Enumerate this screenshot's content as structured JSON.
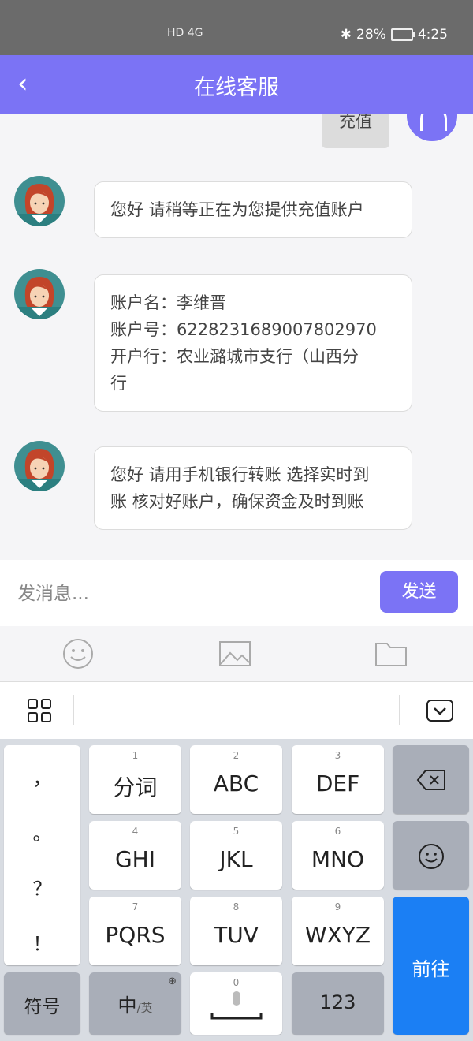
{
  "status_bar": {
    "network": "HD 4G",
    "battery": "28%",
    "time": "4:25"
  },
  "header": {
    "back_icon": "‹",
    "title": "在线客服"
  },
  "sent_message": "充值",
  "messages": [
    {
      "text": "您好  请稍等正在为您提供充值账户"
    },
    {
      "text": "账户名：李维晋\n账户号：6228231689007802970\n开户行：农业潞城市支行（山西分\n行"
    },
    {
      "text": "您好 请用手机银行转账 选择实时到\n账 核对好账户，确保资金及时到账"
    }
  ],
  "input": {
    "placeholder": "发消息...",
    "value": ""
  },
  "send_label": "发送",
  "tool_icons": [
    "emoji-icon",
    "image-icon",
    "folder-icon"
  ],
  "keyboard": {
    "punctuation": [
      "，",
      "。",
      "？",
      "！"
    ],
    "keys": [
      {
        "num": "1",
        "label": "分词"
      },
      {
        "num": "2",
        "label": "ABC"
      },
      {
        "num": "3",
        "label": "DEF"
      },
      {
        "num": "4",
        "label": "GHI"
      },
      {
        "num": "5",
        "label": "JKL"
      },
      {
        "num": "6",
        "label": "MNO"
      },
      {
        "num": "7",
        "label": "PQRS"
      },
      {
        "num": "8",
        "label": "TUV"
      },
      {
        "num": "9",
        "label": "WXYZ"
      }
    ],
    "symbols": "符号",
    "lang_main": "中",
    "lang_sub": "/英",
    "space_num": "0",
    "numbers": "123",
    "go": "前往"
  },
  "colors": {
    "accent": "#7b73f5",
    "go_key": "#1b7ff4"
  }
}
